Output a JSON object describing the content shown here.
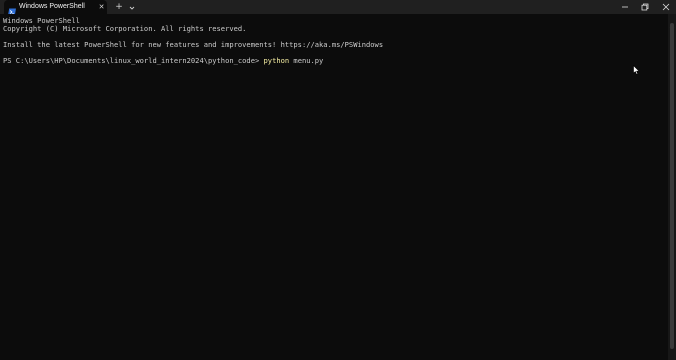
{
  "window": {
    "tab_title": "Windows PowerShell",
    "tab_close_glyph": "✕",
    "new_tab_glyph": "+",
    "icons": {
      "tab": "powershell-icon",
      "dropdown": "chevron-down-icon",
      "minimize": "minimize-icon",
      "maximize": "restore-icon",
      "close": "close-icon"
    }
  },
  "terminal": {
    "lines": [
      "Windows PowerShell",
      "Copyright (C) Microsoft Corporation. All rights reserved.",
      "",
      "Install the latest PowerShell for new features and improvements! https://aka.ms/PSWindows",
      ""
    ],
    "prompt": "PS C:\\Users\\HP\\Documents\\linux_world_intern2024\\python_code> ",
    "command": "python",
    "argument": " menu.py"
  },
  "colors": {
    "background": "#0c0c0c",
    "titlebar": "#202020",
    "text": "#cccccc",
    "command": "#f9f1a5",
    "ps_icon": "#2f6fd6"
  }
}
